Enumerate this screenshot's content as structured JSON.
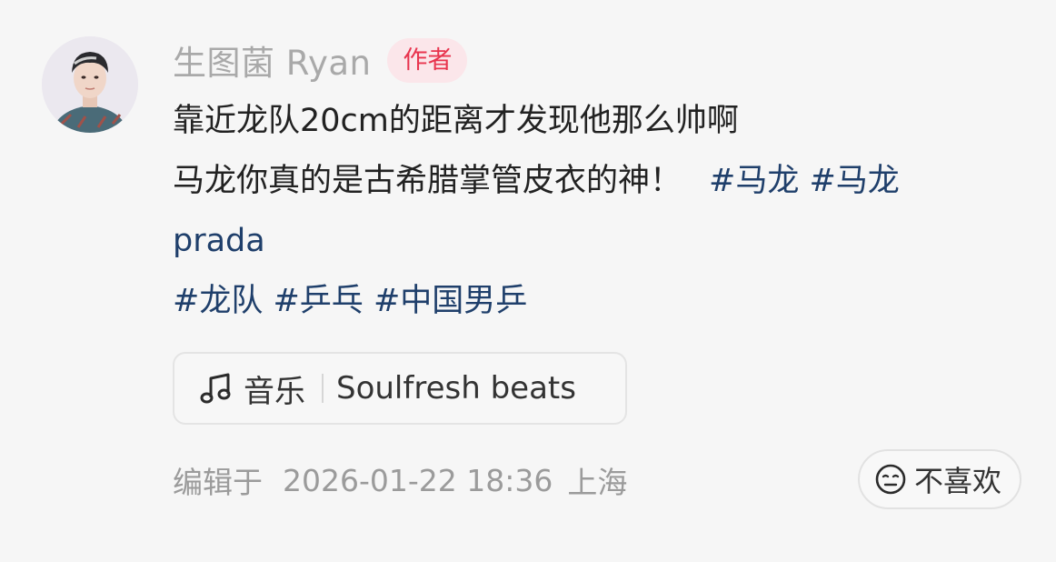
{
  "author": {
    "name": "生图菌 Ryan",
    "tag": "作者",
    "avatar_icon": "profile-photo"
  },
  "post": {
    "line1": "靠近龙队20cm的距离才发现他那么帅啊",
    "line2_text": "马龙你真的是古希腊掌管皮衣的神！",
    "hashtags_line2": [
      "#马龙",
      "#马龙"
    ],
    "line3": "prada",
    "hashtags_line4": [
      "#龙队",
      "#乒乓",
      "#中国男乒"
    ]
  },
  "music": {
    "icon": "music-note-icon",
    "label": "音乐",
    "track": "Soulfresh beats"
  },
  "footer": {
    "edited_label": "编辑于",
    "date": "2026-01-22 18:36",
    "location": "上海"
  },
  "actions": {
    "dislike_label": "不喜欢",
    "dislike_icon": "neutral-face-icon"
  },
  "colors": {
    "hashtag": "#1f3f6b",
    "author_tag_text": "#e8344e",
    "author_tag_bg": "#fbe6ea",
    "muted_text": "#a9a9a9"
  }
}
